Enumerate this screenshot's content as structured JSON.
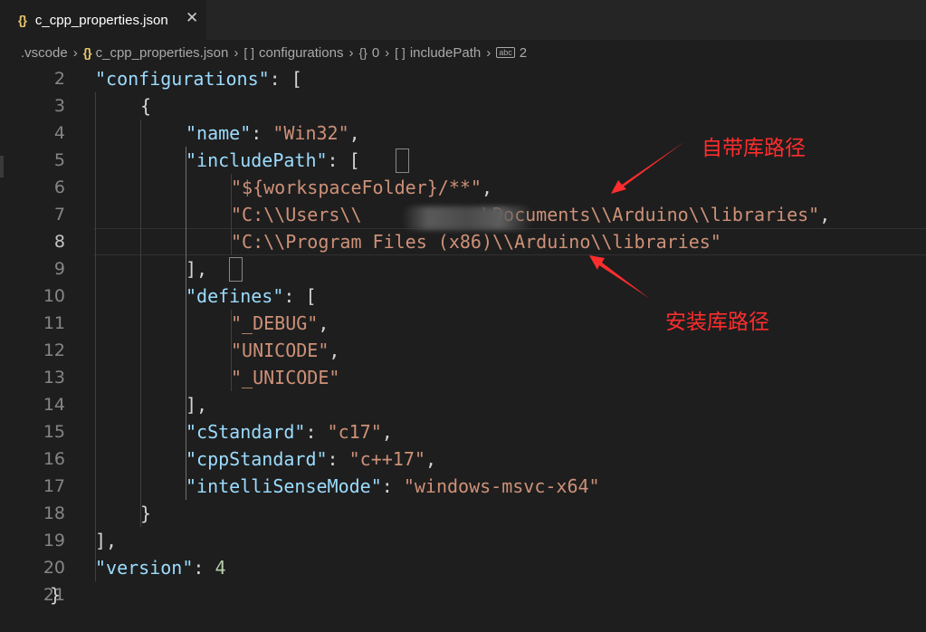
{
  "tab": {
    "icon": "{}",
    "title": "c_cpp_properties.json",
    "close": "✕"
  },
  "breadcrumb": [
    {
      "icon": "",
      "label": ".vscode"
    },
    {
      "icon": "{}",
      "label": "c_cpp_properties.json"
    },
    {
      "icon": "[ ]",
      "label": "configurations"
    },
    {
      "icon": "{}",
      "label": "0"
    },
    {
      "icon": "[ ]",
      "label": "includePath"
    },
    {
      "icon": "abc",
      "label": "2"
    }
  ],
  "editor": {
    "current_line": 8,
    "lines": [
      {
        "num": "2",
        "tokens": [
          [
            "k",
            "\"configurations\""
          ],
          [
            "p",
            ": ["
          ]
        ]
      },
      {
        "num": "3",
        "tokens": [
          [
            "p",
            "{"
          ]
        ]
      },
      {
        "num": "4",
        "tokens": [
          [
            "k",
            "\"name\""
          ],
          [
            "p",
            ": "
          ],
          [
            "s",
            "\"Win32\""
          ],
          [
            "p",
            ","
          ]
        ]
      },
      {
        "num": "5",
        "tokens": [
          [
            "k",
            "\"includePath\""
          ],
          [
            "p",
            ": "
          ],
          [
            "p",
            "["
          ]
        ]
      },
      {
        "num": "6",
        "tokens": [
          [
            "s",
            "\"${workspaceFolder}/**\""
          ],
          [
            "p",
            ","
          ]
        ]
      },
      {
        "num": "7",
        "tokens": [
          [
            "s",
            "\"C:\\\\Users\\\\           \\Documents\\\\Arduino\\\\libraries\""
          ],
          [
            "p",
            ","
          ]
        ]
      },
      {
        "num": "8",
        "tokens": [
          [
            "s",
            "\"C:\\\\Program Files (x86)\\\\Arduino\\\\libraries\""
          ]
        ]
      },
      {
        "num": "9",
        "tokens": [
          [
            "p",
            "]"
          ],
          [
            "p",
            ","
          ]
        ]
      },
      {
        "num": "10",
        "tokens": [
          [
            "k",
            "\"defines\""
          ],
          [
            "p",
            ": ["
          ]
        ]
      },
      {
        "num": "11",
        "tokens": [
          [
            "s",
            "\"_DEBUG\""
          ],
          [
            "p",
            ","
          ]
        ]
      },
      {
        "num": "12",
        "tokens": [
          [
            "s",
            "\"UNICODE\""
          ],
          [
            "p",
            ","
          ]
        ]
      },
      {
        "num": "13",
        "tokens": [
          [
            "s",
            "\"_UNICODE\""
          ]
        ]
      },
      {
        "num": "14",
        "tokens": [
          [
            "p",
            "],"
          ]
        ]
      },
      {
        "num": "15",
        "tokens": [
          [
            "k",
            "\"cStandard\""
          ],
          [
            "p",
            ": "
          ],
          [
            "s",
            "\"c17\""
          ],
          [
            "p",
            ","
          ]
        ]
      },
      {
        "num": "16",
        "tokens": [
          [
            "k",
            "\"cppStandard\""
          ],
          [
            "p",
            ": "
          ],
          [
            "s",
            "\"c++17\""
          ],
          [
            "p",
            ","
          ]
        ]
      },
      {
        "num": "17",
        "tokens": [
          [
            "k",
            "\"intelliSenseMode\""
          ],
          [
            "p",
            ": "
          ],
          [
            "s",
            "\"windows-msvc-x64\""
          ]
        ]
      },
      {
        "num": "18",
        "tokens": [
          [
            "p",
            "}"
          ]
        ]
      },
      {
        "num": "19",
        "tokens": [
          [
            "p",
            "],"
          ]
        ]
      },
      {
        "num": "20",
        "tokens": [
          [
            "k",
            "\"version\""
          ],
          [
            "p",
            ": "
          ],
          [
            "n",
            "4"
          ]
        ]
      },
      {
        "num": "21",
        "tokens": [
          [
            "p",
            "}"
          ]
        ]
      }
    ]
  },
  "annotations": {
    "builtin_library_path": "自带库路径",
    "installed_library_path": "安装库路径",
    "color": "#ff2d2d"
  }
}
